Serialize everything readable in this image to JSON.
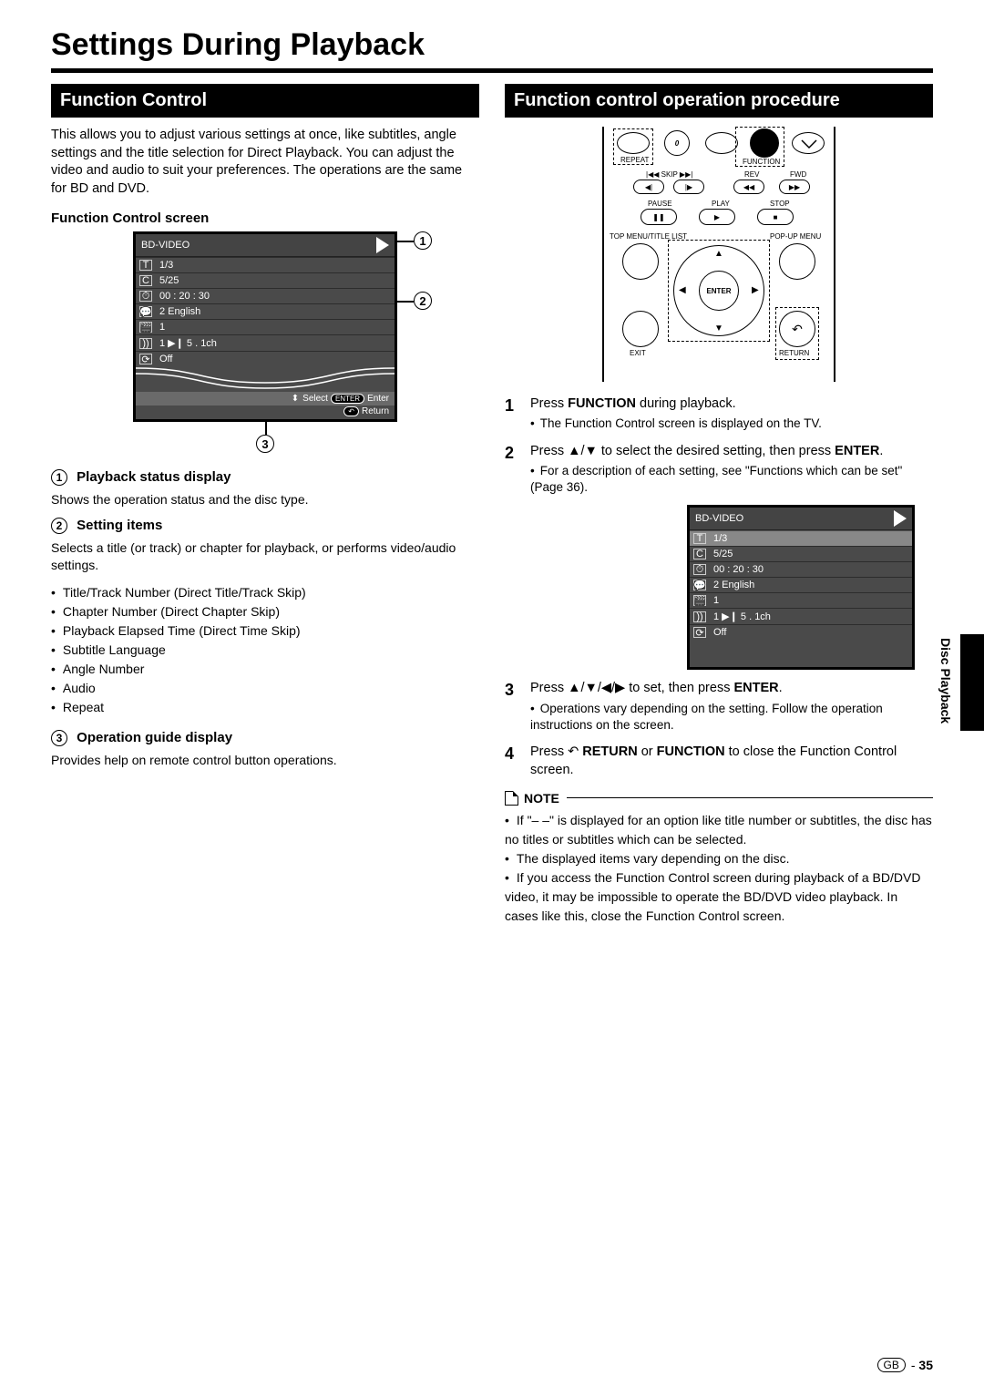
{
  "page_title": "Settings During Playback",
  "side_label": "Disc Playback",
  "footer": {
    "region": "GB",
    "sep": "-",
    "page": "35"
  },
  "left": {
    "heading": "Function Control",
    "intro": "This allows you to adjust various settings at once, like subtitles, angle settings and the title selection for Direct Playback. You can adjust the video and audio to suit your preferences. The operations are the same for BD and DVD.",
    "screen_title": "Function Control screen",
    "osd": {
      "header": "BD-VIDEO",
      "rows": [
        {
          "icon": "T",
          "text": "1/3"
        },
        {
          "icon": "C",
          "text": "5/25"
        },
        {
          "icon": "⏱",
          "text": "00 : 20 : 30"
        },
        {
          "icon": "💬",
          "text": "2 English"
        },
        {
          "icon": "🎬",
          "text": "1"
        },
        {
          "icon": "))",
          "text": "1    ▶❙   5 . 1ch"
        },
        {
          "icon": "⟳",
          "text": "Off"
        }
      ],
      "guide": {
        "select": "Select",
        "enter_pill": "ENTER",
        "enter": "Enter",
        "return_pill": "↶",
        "return": "Return"
      }
    },
    "items": [
      {
        "num": "1",
        "title": "Playback status display",
        "desc": "Shows the operation status and the disc type."
      },
      {
        "num": "2",
        "title": "Setting items",
        "desc": "Selects a title (or track) or chapter for playback, or performs video/audio settings.",
        "bullets": [
          "Title/Track Number (Direct Title/Track Skip)",
          "Chapter Number (Direct Chapter Skip)",
          "Playback Elapsed Time (Direct Time Skip)",
          "Subtitle Language",
          "Angle Number",
          "Audio",
          "Repeat"
        ]
      },
      {
        "num": "3",
        "title": "Operation guide display",
        "desc": "Provides help on remote control button operations."
      }
    ]
  },
  "right": {
    "heading": "Function control operation procedure",
    "remote_labels": {
      "repeat": "REPEAT",
      "zero": "0",
      "function": "FUNCTION",
      "skip": "SKIP",
      "rev": "REV",
      "fwd": "FWD",
      "pause": "PAUSE",
      "play": "PLAY",
      "stop": "STOP",
      "top_menu": "TOP MENU/TITLE LIST",
      "popup": "POP-UP MENU",
      "enter": "ENTER",
      "exit": "EXIT",
      "return": "RETURN"
    },
    "steps": [
      {
        "num": "1",
        "text_before": "Press ",
        "bold1": "FUNCTION",
        "text_after": " during playback.",
        "sub": [
          "The Function Control screen is displayed on the TV."
        ]
      },
      {
        "num": "2",
        "text": "Press ▲/▼ to select the desired setting, then press ",
        "bold1": "ENTER",
        "text_after": ".",
        "sub": [
          "For a description of each setting, see \"Functions which can be set\" (Page 36)."
        ]
      },
      {
        "num": "3",
        "text": "Press ▲/▼/◀/▶ to set, then press ",
        "bold1": "ENTER",
        "text_after": ".",
        "sub": [
          "Operations vary depending on the setting. Follow the operation instructions on the screen."
        ]
      },
      {
        "num": "4",
        "text": "Press ↶ ",
        "bold1": "RETURN",
        "mid": " or ",
        "bold2": "FUNCTION",
        "text_after": " to close the Function Control screen."
      }
    ],
    "osd2": {
      "header": "BD-VIDEO",
      "rows": [
        {
          "icon": "T",
          "text": "1/3",
          "sel": true
        },
        {
          "icon": "C",
          "text": "5/25"
        },
        {
          "icon": "⏱",
          "text": "00 : 20 : 30"
        },
        {
          "icon": "💬",
          "text": "2 English"
        },
        {
          "icon": "🎬",
          "text": "1"
        },
        {
          "icon": "))",
          "text": "1    ▶❙   5 . 1ch"
        },
        {
          "icon": "⟳",
          "text": "Off"
        }
      ]
    },
    "note_label": "NOTE",
    "notes": [
      "If \"– –\" is displayed for an option like title number or subtitles, the disc has no titles or subtitles which can be selected.",
      "The displayed items vary depending on the disc.",
      "If you access the Function Control screen during playback of a BD/DVD video, it may be impossible to operate the BD/DVD video playback. In cases like this, close the Function Control screen."
    ]
  }
}
